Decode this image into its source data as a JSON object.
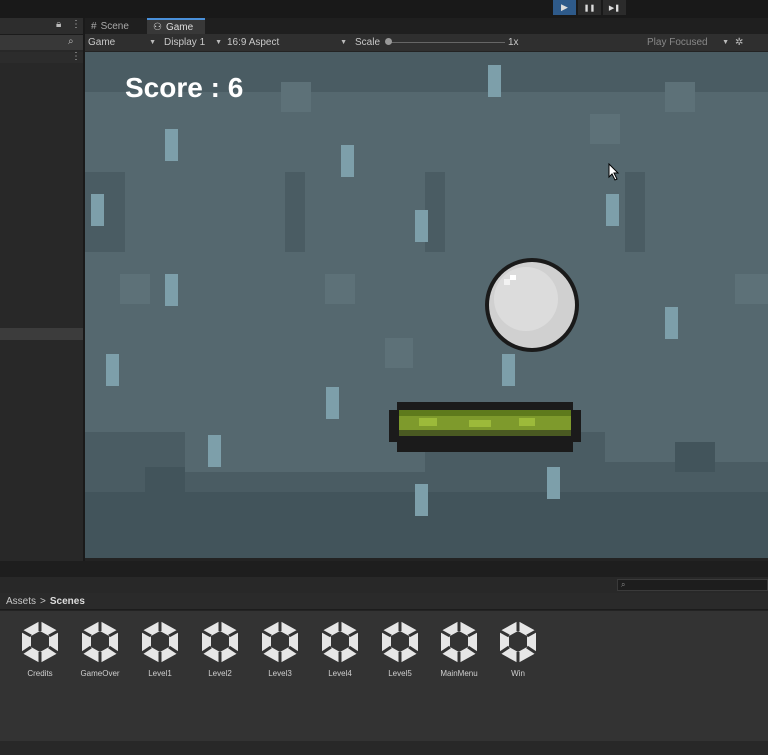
{
  "toolbar": {
    "play_icon": "▶",
    "pause_icon": "❚❚",
    "step_icon": "▶❚"
  },
  "tabs": {
    "scene": "Scene",
    "game": "Game"
  },
  "game_toolbar": {
    "mode": "Game",
    "display": "Display 1",
    "aspect": "16:9 Aspect",
    "scale_label": "Scale",
    "scale_value": "1x",
    "play_focused": "Play Focused"
  },
  "game": {
    "score_text": "Score : 6"
  },
  "project": {
    "breadcrumb_root": "Assets",
    "breadcrumb_sep": ">",
    "breadcrumb_current": "Scenes",
    "scenes": [
      "Credits",
      "GameOver",
      "Level1",
      "Level2",
      "Level3",
      "Level4",
      "Level5",
      "MainMenu",
      "Win"
    ]
  }
}
